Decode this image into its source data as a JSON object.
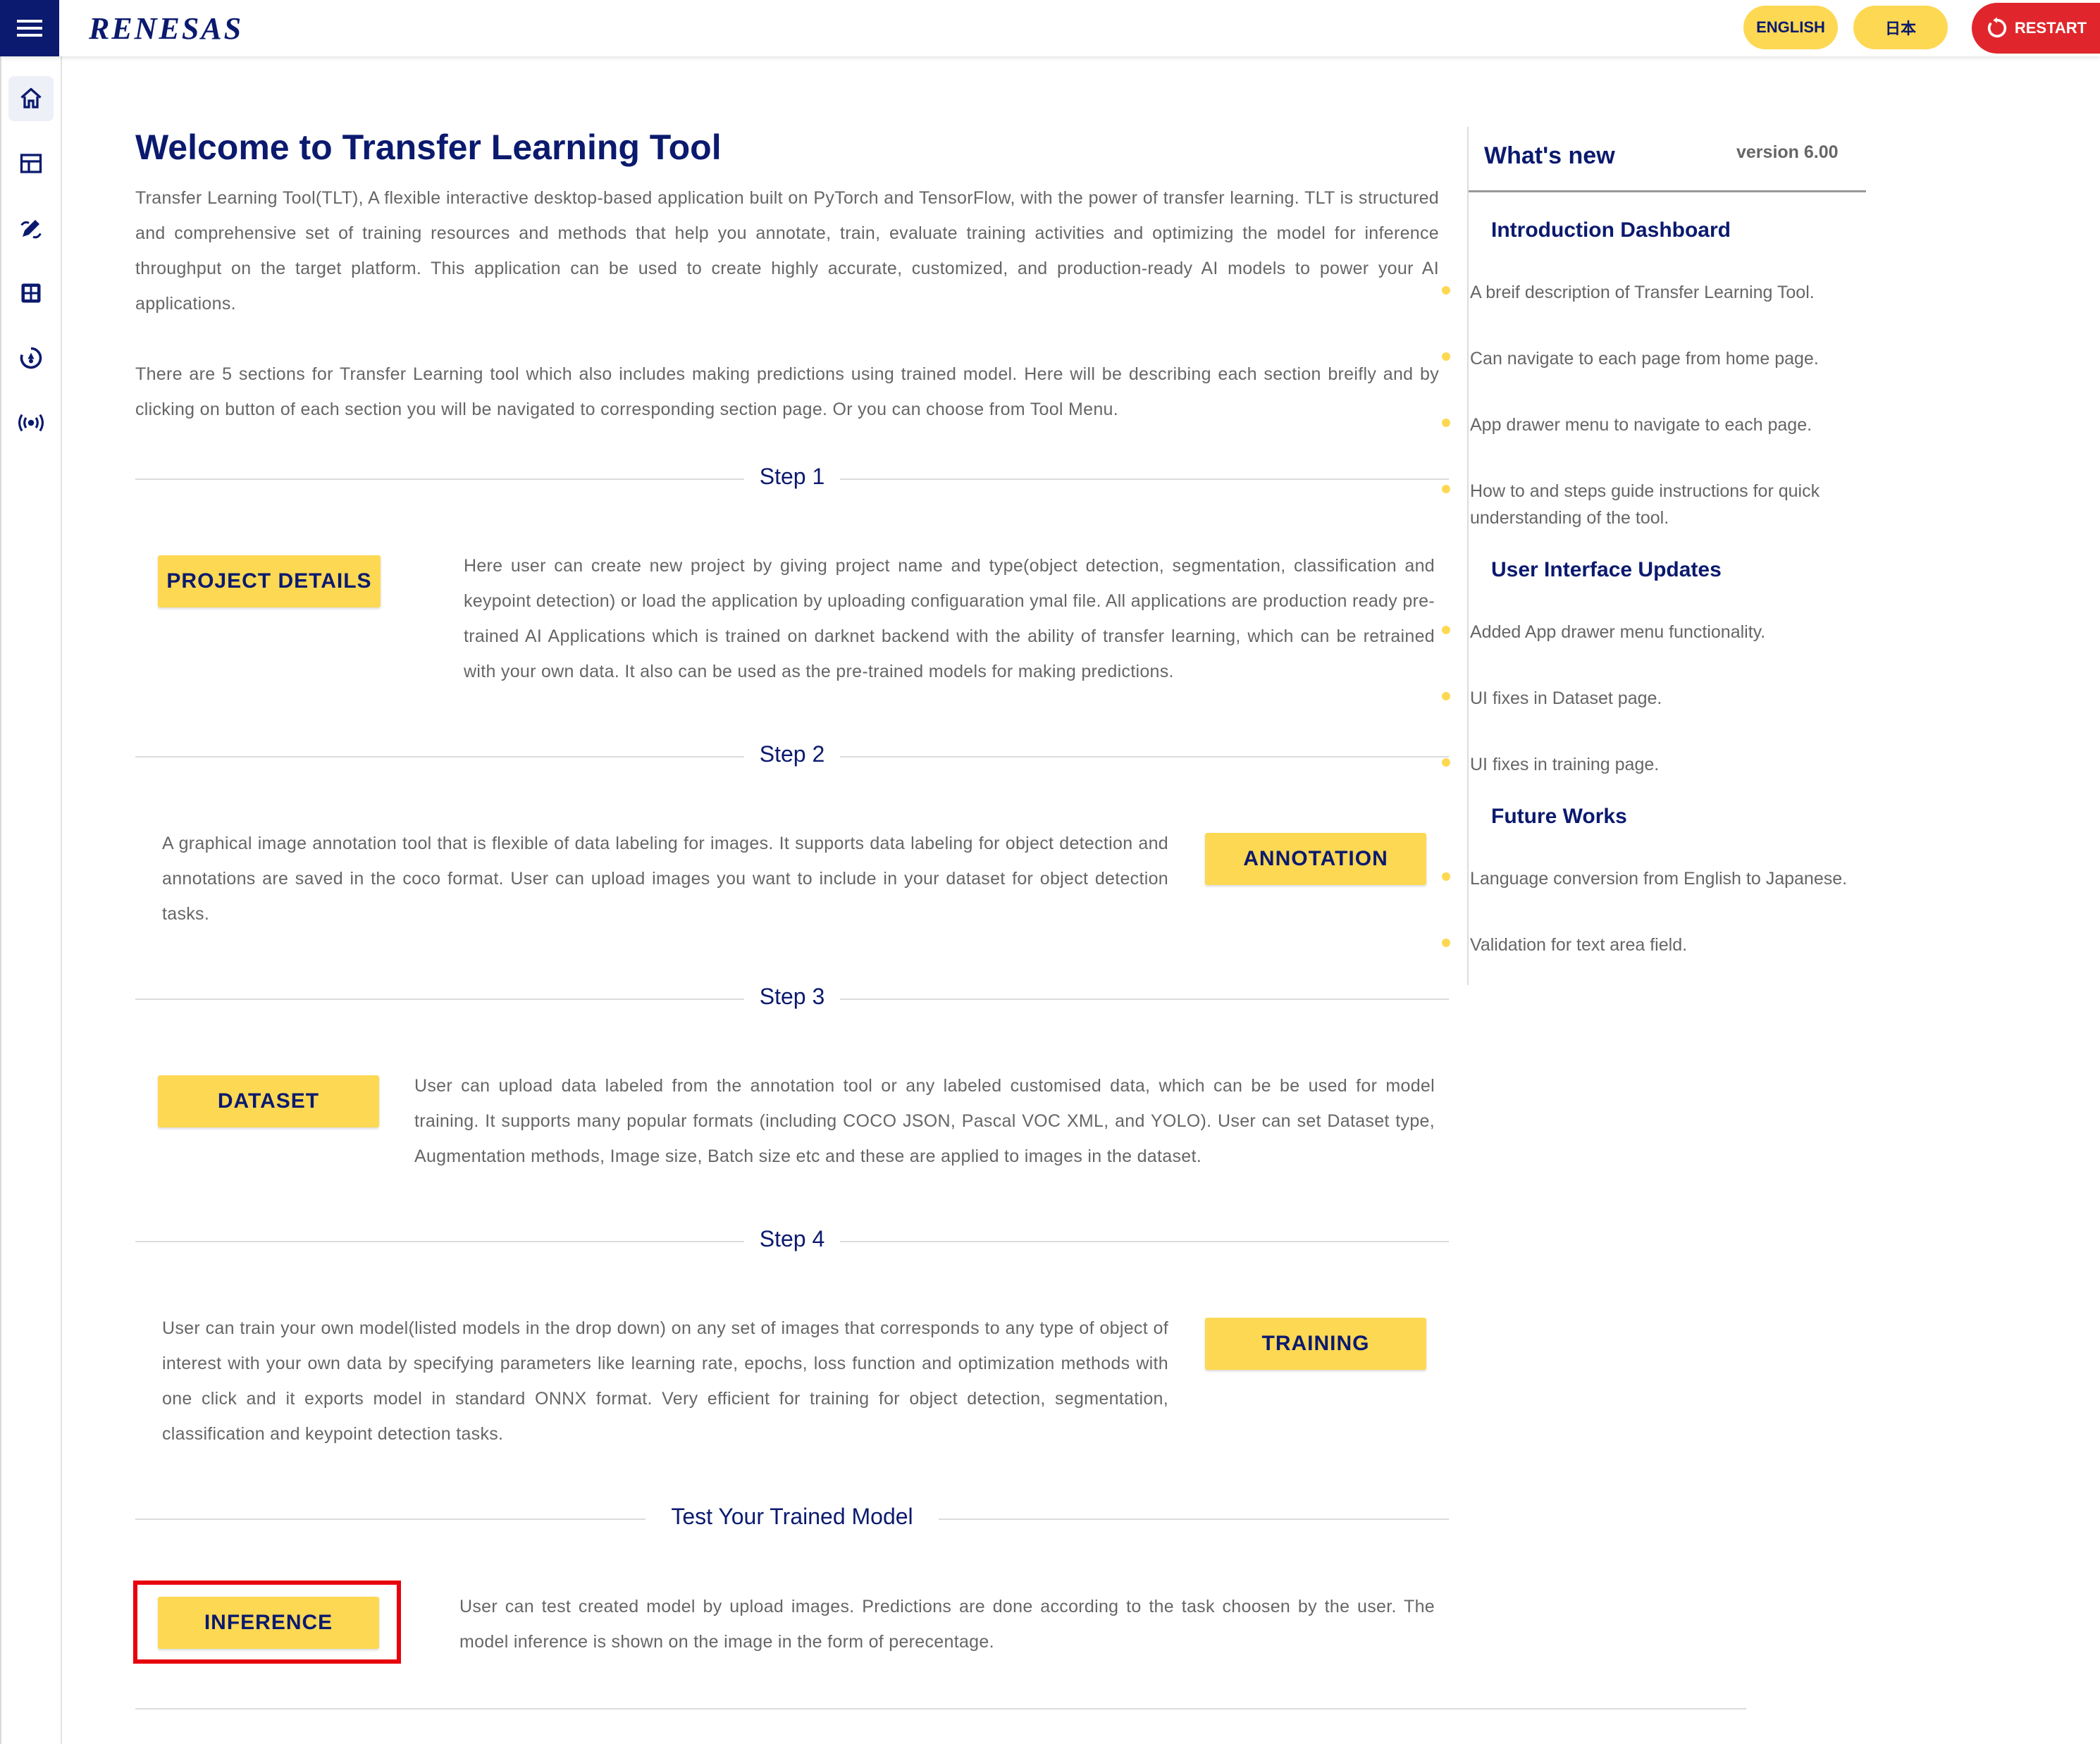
{
  "header": {
    "logo": "RENESAS",
    "lang_english": "ENGLISH",
    "lang_japanese": "日本",
    "restart": "RESTART"
  },
  "sidebar": {
    "items": [
      "home-icon",
      "dashboard-icon",
      "annotation-icon",
      "dataset-icon",
      "training-icon",
      "inference-icon"
    ]
  },
  "main": {
    "title": "Welcome to Transfer Learning Tool",
    "intro_1": "Transfer Learning Tool(TLT), A flexible interactive desktop-based application built on PyTorch and TensorFlow, with the power of transfer learning. TLT is structured and comprehensive set of training resources and methods that help you annotate, train, evaluate training activities and optimizing the model for inference throughput on the target platform. This application can be used to create highly accurate, customized, and production-ready AI models to power your AI applications.",
    "intro_2": "There are 5 sections for Transfer Learning tool which also includes making predictions using trained model. Here will be describing each section breifly and by clicking on button of each section you will be navigated to corresponding section page. Or you can choose from Tool Menu.",
    "steps": [
      {
        "label": "Step 1",
        "button": "PROJECT DETAILS",
        "description": "Here user can create new project by giving project name and type(object detection, segmentation, classification and keypoint detection) or load the application by uploading configuaration ymal file. All applications are production ready pre-trained AI Applications which is trained on darknet backend with the ability of transfer learning, which can be retrained with your own data. It also can be used as the pre-trained models for making predictions."
      },
      {
        "label": "Step 2",
        "button": "ANNOTATION",
        "description": "A graphical image annotation tool that is flexible of data labeling for images. It supports data labeling for object detection and annotations are saved in the coco format. User can upload images you want to include in your dataset for object detection tasks."
      },
      {
        "label": "Step 3",
        "button": "DATASET",
        "description": "User can upload data labeled from the annotation tool or any labeled customised data, which can be be used for model training. It supports many popular formats (including COCO JSON, Pascal VOC XML, and YOLO). User can set Dataset type, Augmentation methods, Image size, Batch size etc and these are applied to images in the dataset."
      },
      {
        "label": "Step 4",
        "button": "TRAINING",
        "description": "User can train your own model(listed models in the drop down) on any set of images that corresponds to any type of object of interest with your own data by specifying parameters like learning rate, epochs, loss function and optimization methods with one click and it exports model in standard ONNX format. Very efficient for training for object detection, segmentation, classification and keypoint detection tasks."
      },
      {
        "label": "Test Your Trained Model",
        "button": "INFERENCE",
        "description": "User can test created model by upload images. Predictions are done according to the task choosen by the user. The model inference is shown on the image in the form of perecentage."
      }
    ]
  },
  "whats_new": {
    "title": "What's new",
    "version": "version 6.00",
    "sections": [
      {
        "heading": "Introduction Dashboard",
        "items": [
          "A breif description of Transfer Learning Tool.",
          "Can navigate to each page from home page.",
          "App drawer menu to navigate to each page.",
          "How to and steps guide instructions for quick understanding of the tool."
        ]
      },
      {
        "heading": "User Interface Updates",
        "items": [
          "Added App drawer menu functionality.",
          "UI fixes in Dataset page.",
          "UI fixes in training page."
        ]
      },
      {
        "heading": "Future Works",
        "items": [
          "Language conversion from English to Japanese.",
          "Validation for text area field."
        ]
      }
    ]
  },
  "colors": {
    "navy": "#0b1a6e",
    "yellow": "#fdd853",
    "red": "#e0262c",
    "highlight": "#e8000c"
  }
}
